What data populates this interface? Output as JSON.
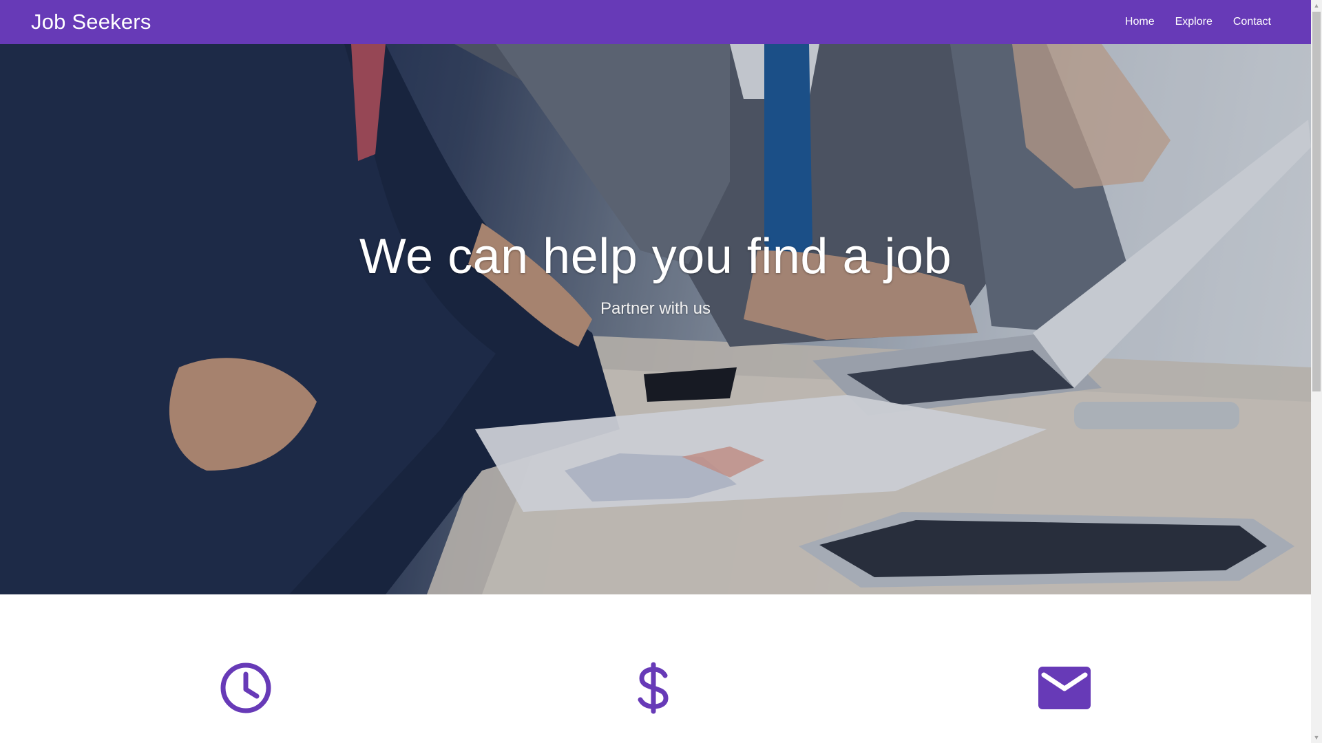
{
  "navbar": {
    "brand": "Job Seekers",
    "links": [
      {
        "label": "Home"
      },
      {
        "label": "Explore"
      },
      {
        "label": "Contact"
      }
    ],
    "color": "#673ab7"
  },
  "hero": {
    "title": "We can help you find a job",
    "subtitle": "Partner with us"
  },
  "features": {
    "icons": [
      "clock-icon",
      "dollar-icon",
      "mail-icon"
    ],
    "icon_color": "#673ab7"
  }
}
